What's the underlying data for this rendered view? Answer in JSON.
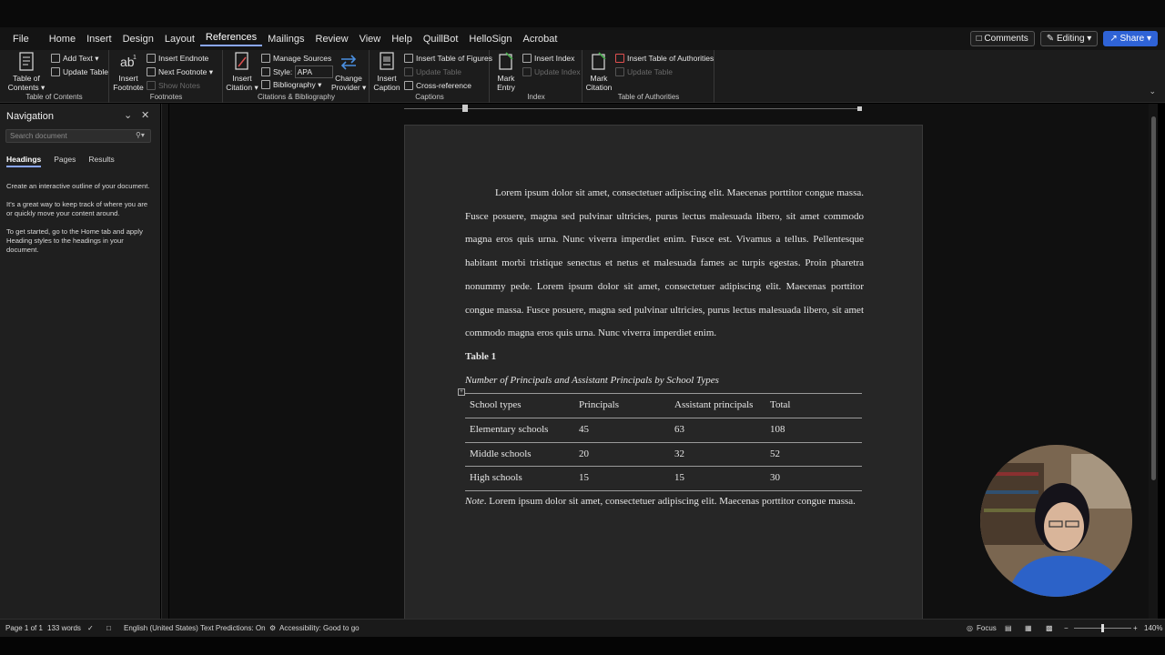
{
  "menubar": {
    "tabs": [
      "File",
      "Home",
      "Insert",
      "Design",
      "Layout",
      "References",
      "Mailings",
      "Review",
      "View",
      "Help",
      "QuillBot",
      "HelloSign",
      "Acrobat"
    ],
    "active_tab": "References",
    "comments_label": "Comments",
    "editing_label": "Editing",
    "share_label": "Share"
  },
  "ribbon": {
    "toc": {
      "table_of_contents": "Table of",
      "table_of_contents2": "Contents",
      "add_text": "Add Text",
      "update_table": "Update Table",
      "label": "Table of Contents"
    },
    "footnotes": {
      "insert_footnote": "Insert",
      "insert_footnote2": "Footnote",
      "insert_endnote": "Insert Endnote",
      "next_footnote": "Next Footnote",
      "show_notes": "Show Notes",
      "label": "Footnotes"
    },
    "citations": {
      "insert_citation": "Insert",
      "insert_citation2": "Citation",
      "manage_sources": "Manage Sources",
      "style_label": "Style:",
      "style_value": "APA",
      "bibliography": "Bibliography",
      "change_provider": "Change",
      "change_provider2": "Provider",
      "label": "Citations & Bibliography"
    },
    "captions": {
      "insert_caption": "Insert",
      "insert_caption2": "Caption",
      "insert_tof": "Insert Table of Figures",
      "update_table": "Update Table",
      "cross_reference": "Cross-reference",
      "label": "Captions"
    },
    "index": {
      "mark_entry": "Mark",
      "mark_entry2": "Entry",
      "insert_index": "Insert Index",
      "update_index": "Update Index",
      "label": "Index"
    },
    "authorities": {
      "mark_citation": "Mark",
      "mark_citation2": "Citation",
      "insert_toa": "Insert Table of Authorities",
      "update_table": "Update Table",
      "label": "Table of Authorities"
    }
  },
  "navigation": {
    "title": "Navigation",
    "search_placeholder": "Search document",
    "tabs": [
      "Headings",
      "Pages",
      "Results"
    ],
    "help": [
      "Create an interactive outline of your document.",
      "It's a great way to keep track of where you are or quickly move your content around.",
      "To get started, go to the Home tab and apply Heading styles to the headings in your document."
    ]
  },
  "document": {
    "paragraph": "Lorem ipsum dolor sit amet, consectetuer adipiscing elit. Maecenas porttitor congue massa. Fusce posuere, magna sed pulvinar ultricies, purus lectus malesuada libero, sit amet commodo magna eros quis urna. Nunc viverra imperdiet enim. Fusce est. Vivamus a tellus. Pellentesque habitant morbi tristique senectus et netus et malesuada fames ac turpis egestas. Proin pharetra nonummy pede. Lorem ipsum dolor sit amet, consectetuer adipiscing elit. Maecenas porttitor congue massa. Fusce posuere, magna sed pulvinar ultricies, purus lectus malesuada libero, sit amet commodo magna eros quis urna. Nunc viverra imperdiet enim.",
    "table_label": "Table 1",
    "table_caption": "Number of Principals and Assistant Principals by School Types",
    "table": {
      "headers": [
        "School types",
        "Principals",
        "Assistant principals",
        "Total"
      ],
      "rows": [
        [
          "Elementary schools",
          "45",
          "63",
          "108"
        ],
        [
          "Middle schools",
          "20",
          "32",
          "52"
        ],
        [
          "High schools",
          "15",
          "15",
          "30"
        ]
      ]
    },
    "note_label": "Note",
    "note_text": ". Lorem ipsum dolor sit amet, consectetuer adipiscing elit. Maecenas porttitor congue massa."
  },
  "statusbar": {
    "page": "Page 1 of 1",
    "words": "133 words",
    "language": "English (United States)",
    "text_predictions": "Text Predictions: On",
    "accessibility": "Accessibility: Good to go",
    "focus": "Focus",
    "zoom": "140%"
  },
  "colors": {
    "accent": "#2f63d6",
    "tab_underline": "#8aa6ff"
  }
}
